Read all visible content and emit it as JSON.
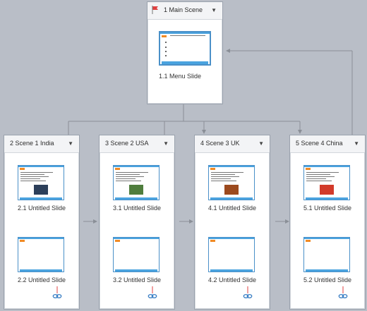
{
  "main_scene": {
    "title": "1 Main Scene",
    "slide_label": "1.1 Menu Slide"
  },
  "scenes": [
    {
      "title": "2 Scene 1 India",
      "slides": [
        "2.1 Untitled Slide",
        "2.2 Untitled Slide"
      ],
      "photo_color": "#2c3f5a"
    },
    {
      "title": "3 Scene 2 USA",
      "slides": [
        "3.1 Untitled Slide",
        "3.2 Untitled Slide"
      ],
      "photo_color": "#4f7d3d"
    },
    {
      "title": "4 Scene 3 UK",
      "slides": [
        "4.1 Untitled Slide",
        "4.2 Untitled Slide"
      ],
      "photo_color": "#9c4a1e"
    },
    {
      "title": "5 Scene 4 China",
      "slides": [
        "5.1 Untitled Slide",
        "5.2 Untitled Slide"
      ],
      "photo_color": "#d23a2a"
    }
  ],
  "icons": {
    "header_flag": "flag-icon",
    "dropdown": "chevron-down-icon",
    "link": "link-icon"
  },
  "colors": {
    "canvas": "#b9bec7",
    "connector": "#8a8f97",
    "link": "#3b7fc4",
    "flag": "#e04040",
    "slide_accent": "#4aa3df"
  }
}
